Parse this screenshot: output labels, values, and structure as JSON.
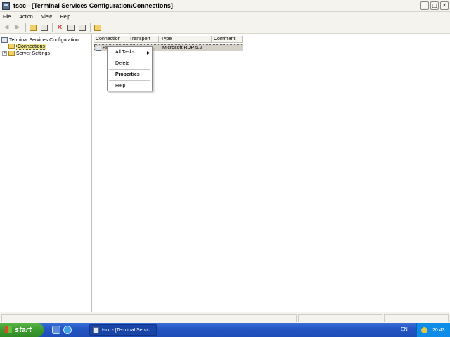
{
  "window": {
    "title": "tscc - [Terminal Services Configuration\\Connections]",
    "buttons": [
      "_",
      "□",
      "✕"
    ]
  },
  "menubar": {
    "items": [
      "File",
      "Action",
      "View",
      "Help"
    ]
  },
  "toolbar": {
    "buttons": [
      "back-icon",
      "forward-icon",
      "up-folder-icon",
      "show-tree-icon",
      "delete-icon",
      "properties-icon",
      "export-icon",
      "help-icon"
    ]
  },
  "tree": {
    "root": "Terminal Services Configuration",
    "children": [
      {
        "label": "Connections",
        "selected": true
      },
      {
        "label": "Server Settings",
        "selected": false
      }
    ]
  },
  "list": {
    "columns": [
      "Connection",
      "Transport",
      "Type",
      "Comment"
    ],
    "rows": [
      {
        "connection": "RDP-Tcp",
        "transport": "tcp",
        "type": "Microsoft RDP 5.2",
        "comment": ""
      }
    ]
  },
  "context_menu": {
    "items": [
      "All Tasks",
      "Delete",
      "Properties",
      "Help"
    ]
  },
  "taskbar": {
    "start_label": "start",
    "task_label": "tscc - [Terminal Servic...",
    "language": "EN",
    "clock": "20:43"
  }
}
